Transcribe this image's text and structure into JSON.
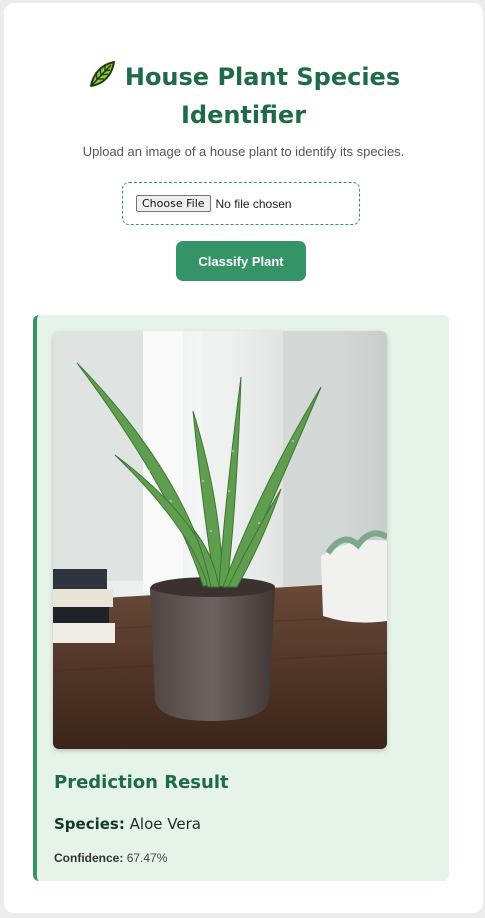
{
  "header": {
    "icon": "leaf-icon",
    "title_line1": "House Plant Species",
    "title_line2": "Identifier",
    "subtitle": "Upload an image of a house plant to identify its species."
  },
  "upload": {
    "button_label": "Choose File",
    "status": "No file chosen"
  },
  "actions": {
    "classify_label": "Classify Plant"
  },
  "result": {
    "heading": "Prediction Result",
    "species_label": "Species:",
    "species_value": "Aloe Vera",
    "confidence_label": "Confidence:",
    "confidence_value": "67.47%",
    "image_alt": "Aloe vera plant in a grey pot"
  },
  "colors": {
    "brand_green": "#1f6b48",
    "button_green": "#359467",
    "result_bg": "#e6f3e9"
  }
}
